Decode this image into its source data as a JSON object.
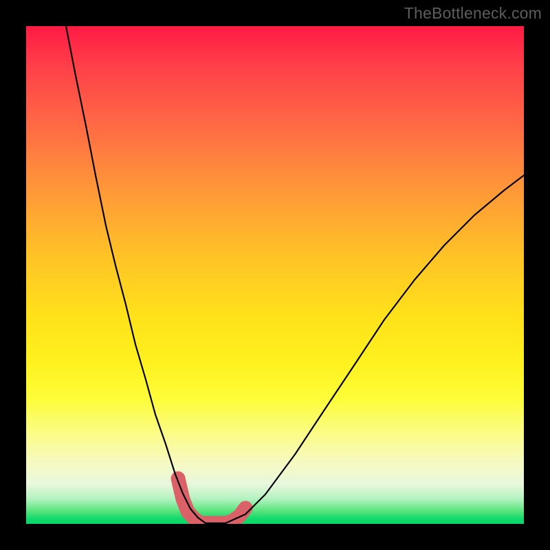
{
  "watermark": "TheBottleneck.com",
  "chart_data": {
    "type": "line",
    "title": "",
    "xlabel": "",
    "ylabel": "",
    "xlim": [
      0,
      100
    ],
    "ylim": [
      0,
      100
    ],
    "grid": false,
    "series": [
      {
        "name": "curve",
        "x": [
          8,
          10,
          12,
          14,
          16,
          18,
          20,
          22,
          24,
          26,
          28,
          30,
          31.5,
          33,
          34.5,
          36,
          40,
          44,
          48,
          54,
          60,
          66,
          72,
          78,
          84,
          90,
          96,
          100
        ],
        "y": [
          100,
          90,
          80,
          70,
          60,
          52,
          44,
          36,
          29,
          22,
          16,
          10,
          6,
          3,
          1.2,
          0,
          0,
          2,
          6,
          14,
          23,
          32,
          41,
          49,
          56,
          62,
          67,
          70
        ]
      }
    ],
    "highlight_band": {
      "name": "highlighted-segment",
      "x": [
        30.5,
        31.5,
        32.5,
        33.5,
        35,
        36.5,
        38,
        40,
        41.5,
        43,
        44
      ],
      "y": [
        9,
        5,
        2.5,
        1.2,
        0,
        0,
        0,
        0,
        0.6,
        1.6,
        3.2
      ]
    },
    "colors": {
      "curve": "#000000",
      "highlight": "#da6167",
      "background_top": "#ff1a44",
      "background_bottom": "#09d768"
    }
  }
}
